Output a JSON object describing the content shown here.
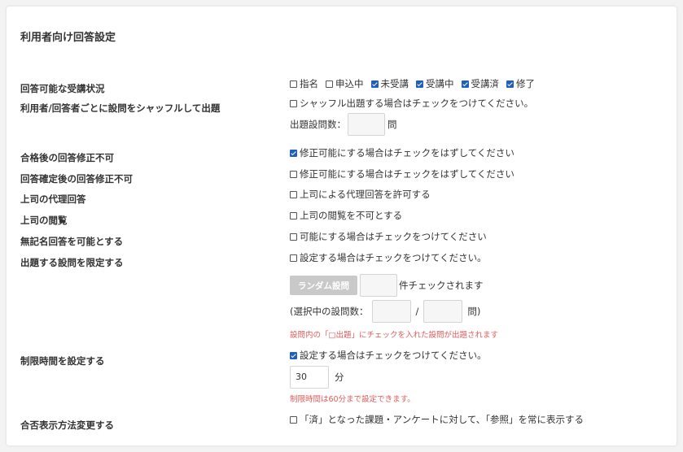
{
  "section_title": "利用者向け回答設定",
  "attendance": {
    "label": "回答可能な受講状況",
    "options": [
      {
        "label": "指名",
        "checked": false
      },
      {
        "label": "申込中",
        "checked": false
      },
      {
        "label": "未受講",
        "checked": true
      },
      {
        "label": "受講中",
        "checked": true
      },
      {
        "label": "受講済",
        "checked": true
      },
      {
        "label": "修了",
        "checked": true
      }
    ]
  },
  "shuffle": {
    "label": "利用者/回答者ごとに設問をシャッフルして出題",
    "checkbox_label": "シャッフル出題する場合はチェックをつけてください。",
    "count_label": "出題設問数：",
    "count_value": "",
    "count_unit": "問"
  },
  "settings": [
    {
      "label": "合格後の回答修正不可",
      "checkbox_label": "修正可能にする場合はチェックをはずしてください",
      "checked": true
    },
    {
      "label": "回答確定後の回答修正不可",
      "checkbox_label": "修正可能にする場合はチェックをはずしてください",
      "checked": false
    },
    {
      "label": "上司の代理回答",
      "checkbox_label": "上司による代理回答を許可する",
      "checked": false
    },
    {
      "label": "上司の閲覧",
      "checkbox_label": "上司の閲覧を不可とする",
      "checked": false
    },
    {
      "label": "無記名回答を可能とする",
      "checkbox_label": "可能にする場合はチェックをつけてください",
      "checked": false
    }
  ],
  "limit_questions": {
    "label": "出題する設問を限定する",
    "checkbox_label": "設定する場合はチェックをつけてください。",
    "checked": false,
    "random_button": "ランダム設問",
    "random_value": "",
    "random_suffix": "件チェックされます",
    "selected_prefix": "(選択中の設問数：",
    "selected_value": "",
    "separator": "/",
    "total_value": "",
    "selected_suffix": "問)",
    "note": "設問内の「□出題」にチェックを入れた設問が出題されます"
  },
  "time_limit": {
    "label": "制限時間を設定する",
    "checkbox_label": "設定する場合はチェックをつけてください。",
    "checked": true,
    "value": "30",
    "unit": "分",
    "note": "制限時間は60分まで設定できます。"
  },
  "result_display": {
    "label": "合否表示方法変更する",
    "checkbox_label": "「済」となった課題・アンケートに対して、「参照」を常に表示する",
    "checked": false
  },
  "colors": {
    "accent": "#1f5fbf",
    "note": "#e25b5b",
    "button": "#c9c9c9"
  }
}
